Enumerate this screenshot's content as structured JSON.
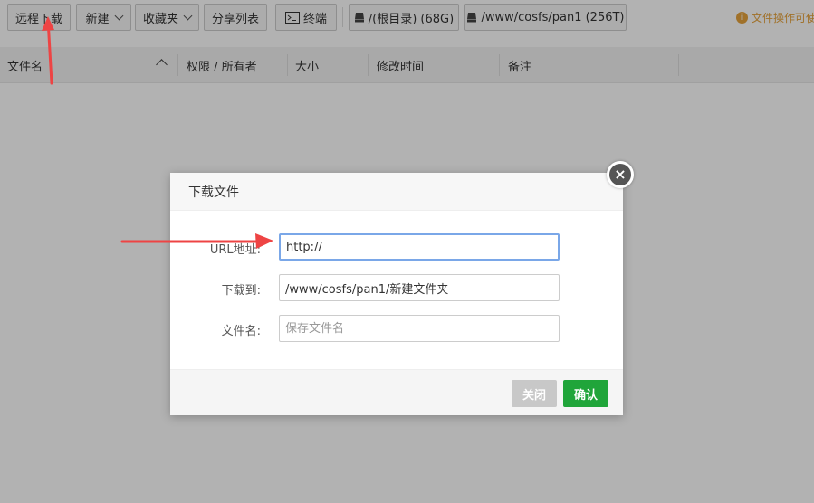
{
  "toolbar": {
    "remote_download": "远程下载",
    "new": "新建",
    "favorites": "收藏夹",
    "share_list": "分享列表",
    "terminal": "终端",
    "root_disk": "/(根目录) (68G)",
    "pan_disk": "/www/cosfs/pan1 (256T)",
    "notice": "文件操作可使"
  },
  "table": {
    "columns": [
      "文件名",
      "权限 / 所有者",
      "大小",
      "修改时间",
      "备注"
    ]
  },
  "dialog": {
    "title": "下载文件",
    "url_label": "URL地址:",
    "url_value": "http://",
    "dest_label": "下载到:",
    "dest_value": "/www/cosfs/pan1/新建文件夹",
    "filename_label": "文件名:",
    "filename_placeholder": "保存文件名",
    "close_label": "关闭",
    "confirm_label": "确认"
  },
  "colors": {
    "confirm": "#20a53a",
    "close": "#c8c8c8",
    "annotation_arrow": "#ee4444",
    "notice": "#e6a23c"
  }
}
